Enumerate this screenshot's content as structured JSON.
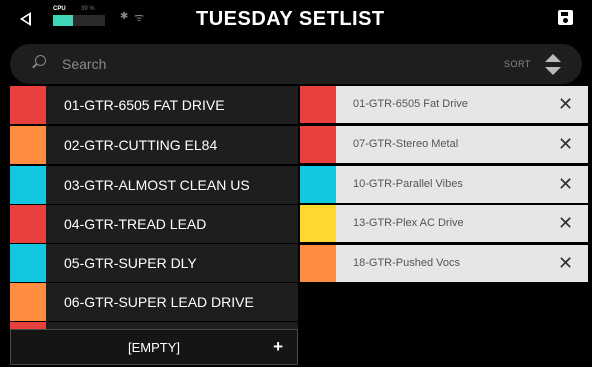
{
  "header": {
    "title": "TUESDAY SETLIST",
    "cpu_label": "CPU",
    "cpu_percent_text": "39 %",
    "cpu_fraction": 0.39,
    "back_icon": "back-arrow-icon",
    "bluetooth_icon": "bluetooth-icon",
    "wifi_icon": "wifi-icon",
    "save_icon": "save-icon"
  },
  "search": {
    "placeholder": "Search",
    "value": "",
    "sort_label": "SORT"
  },
  "presets": [
    {
      "label": "01-GTR-6505 FAT DRIVE",
      "color": "#e8403f"
    },
    {
      "label": "02-GTR-CUTTING EL84",
      "color": "#ff8c3f"
    },
    {
      "label": "03-GTR-ALMOST CLEAN US",
      "color": "#12c8e0"
    },
    {
      "label": "04-GTR-TREAD LEAD",
      "color": "#e8403f"
    },
    {
      "label": "05-GTR-SUPER DLY",
      "color": "#12c8e0"
    },
    {
      "label": "06-GTR-SUPER LEAD DRIVE",
      "color": "#ff8c3f"
    },
    {
      "label": "",
      "color": "#e8403f"
    }
  ],
  "empty_slot": {
    "label": "[EMPTY]",
    "add_symbol": "+"
  },
  "setlist": [
    {
      "label": "01-GTR-6505 Fat Drive",
      "color": "#e8403f"
    },
    {
      "label": "07-GTR-Stereo Metal",
      "color": "#e8403f"
    },
    {
      "label": "10-GTR-Parallel Vibes",
      "color": "#12c8e0"
    },
    {
      "label": "13-GTR-Plex AC Drive",
      "color": "#ffd92e"
    },
    {
      "label": "18-GTR-Pushed Vocs",
      "color": "#ff8c3f"
    }
  ],
  "remove_symbol": "✕"
}
